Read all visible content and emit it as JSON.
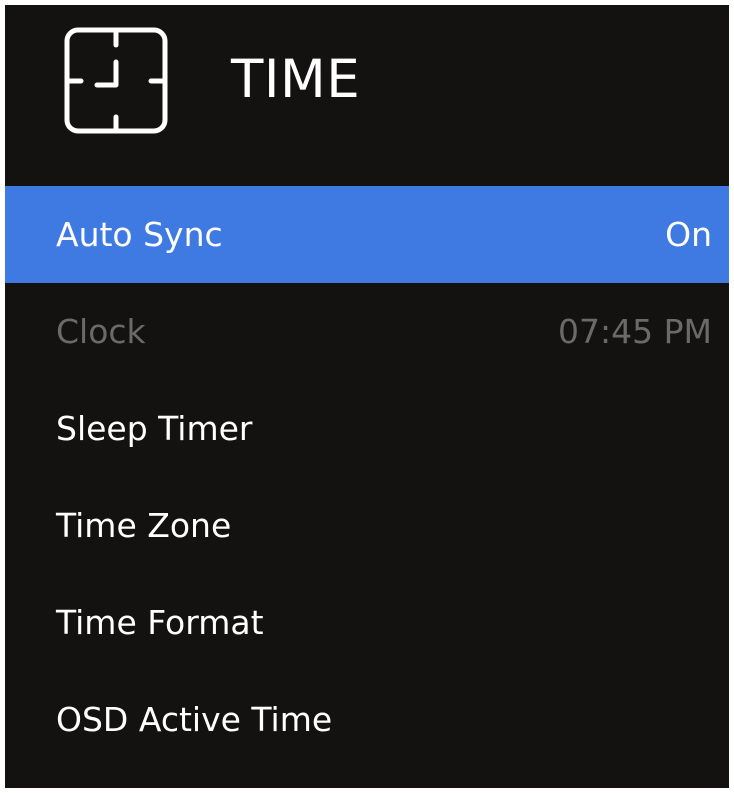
{
  "menu": {
    "title": "TIME",
    "icon": "clock-icon",
    "colors": {
      "background": "#141111",
      "selected": "#3f7ae3",
      "text": "#ffffff",
      "disabled_text": "#6a6a6a"
    },
    "items": [
      {
        "label": "Auto Sync",
        "value": "On",
        "state": "selected"
      },
      {
        "label": "Clock",
        "value": "07:45 PM",
        "state": "disabled"
      },
      {
        "label": "Sleep Timer",
        "value": "",
        "state": "normal"
      },
      {
        "label": "Time Zone",
        "value": "",
        "state": "normal"
      },
      {
        "label": "Time Format",
        "value": "",
        "state": "normal"
      },
      {
        "label": "OSD Active Time",
        "value": "",
        "state": "normal"
      }
    ]
  }
}
